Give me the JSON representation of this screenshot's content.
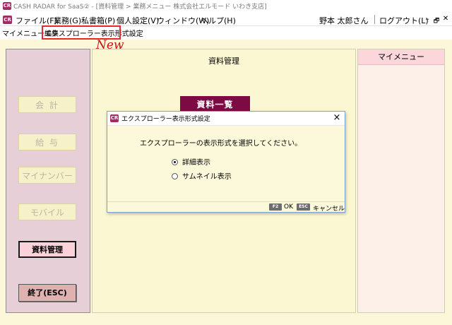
{
  "window": {
    "title": "CASH RADAR for SaaS② - [資料管理 > 業務メニュー 株式会社エルモード いわき支店]",
    "logo_text": "CR"
  },
  "menubar": {
    "items": [
      "ファイル(F)",
      "業務(G)",
      "私書箱(P)",
      "個人設定(V)",
      "ウィンドウ(W)",
      "ヘルプ(H)"
    ],
    "user": "野本 太郎さん",
    "logout": "ログアウト(L)",
    "controls": [
      "–",
      "🗗",
      "✕"
    ]
  },
  "submenu": {
    "items": [
      "マイメニュー編集",
      "エクスプローラー表示形式設定"
    ],
    "new_label": "New"
  },
  "left_nav": {
    "buttons": [
      "会 計",
      "給 与",
      "マイナンバー",
      "モバイル",
      "資料管理",
      "終了(ESC)"
    ]
  },
  "center": {
    "title": "資料管理",
    "list_button": "資料一覧"
  },
  "right": {
    "title": "マイメニュー"
  },
  "dialog": {
    "title": "エクスプローラー表示形式設定",
    "message": "エクスプローラーの表示形式を選択してください。",
    "options": [
      "詳細表示",
      "サムネイル表示"
    ],
    "selected": "詳細表示",
    "footer": {
      "ok_key": "F2",
      "ok_label": "OK",
      "cancel_key": "ESC",
      "cancel_label": "キャンセル"
    }
  },
  "colors": {
    "accent": "#7e0a43",
    "highlight": "#e8282a",
    "background": "#fcf7d8"
  }
}
